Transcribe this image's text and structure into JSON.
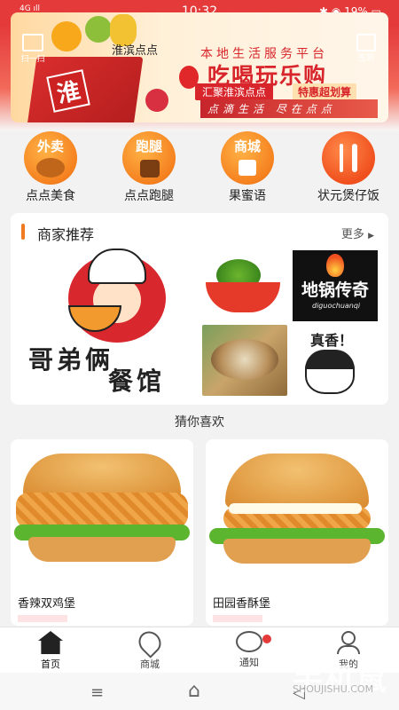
{
  "status_bar": {
    "left": "4G ıll",
    "time": "10:32",
    "battery": "19%"
  },
  "header": {
    "scan_label": "扫一扫",
    "title": "淮滨点点",
    "signin_label": "签到"
  },
  "banner": {
    "crate_text": "淮",
    "top_line": "本地生活服务平台",
    "headline": "吃喝玩乐购",
    "tag1": "汇聚淮滨点点",
    "tag2": "特惠超划算",
    "bottom_line": "点滴生活 尽在点点"
  },
  "categories": [
    {
      "badge": "外卖",
      "label": "点点美食",
      "icon": "chicken-icon"
    },
    {
      "badge": "跑腿",
      "label": "点点跑腿",
      "icon": "courier-icon"
    },
    {
      "badge": "商城",
      "label": "果蜜语",
      "icon": "shopping-bag-icon"
    },
    {
      "badge": "",
      "label": "状元煲仔饭",
      "icon": "fork-knife-icon"
    }
  ],
  "merchants": {
    "heading": "商家推荐",
    "more": "更多",
    "items": [
      {
        "name": "哥弟俩餐馆",
        "line1": "哥弟俩",
        "line2": "餐馆"
      },
      {
        "name": "salad"
      },
      {
        "name": "地锅传奇",
        "big": "地锅传奇",
        "small": "diguochuanqi"
      },
      {
        "name": "stew"
      },
      {
        "name": "真香",
        "caption": "真香！"
      }
    ]
  },
  "guess": {
    "heading": "猜你喜欢",
    "products": [
      {
        "name": "香辣双鸡堡"
      },
      {
        "name": "田园香酥堡"
      }
    ]
  },
  "tabbar": [
    {
      "label": "首页",
      "icon": "home-icon",
      "active": true
    },
    {
      "label": "商城",
      "icon": "map-pin-icon",
      "active": false
    },
    {
      "label": "通知",
      "icon": "chat-bubble-icon",
      "active": false,
      "badge": true
    },
    {
      "label": "我的",
      "icon": "person-icon",
      "active": false
    }
  ],
  "system_nav": {
    "menu": "≡",
    "home": "⌂",
    "back": "◁"
  },
  "watermark": {
    "main": "手机鼠",
    "sub": "SHOUJISHU.COM"
  },
  "colors": {
    "brand_red": "#e43a3a",
    "accent_orange": "#f07a20"
  }
}
